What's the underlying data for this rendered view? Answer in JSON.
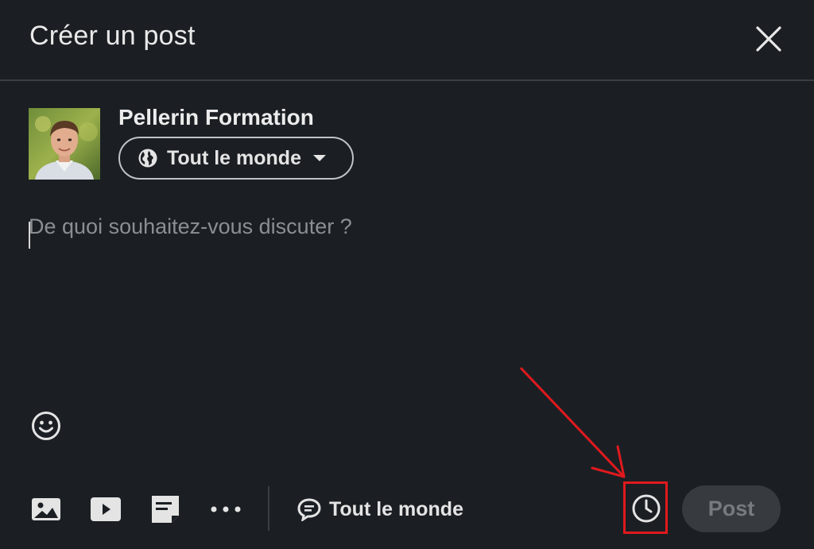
{
  "header": {
    "title": "Créer un post"
  },
  "author": {
    "name": "Pellerin Formation",
    "audience_label": "Tout le monde"
  },
  "composer": {
    "placeholder": "De quoi souhaitez-vous discuter ?"
  },
  "toolbar": {
    "icons": [
      "image-icon",
      "video-icon",
      "document-icon",
      "more-icon"
    ],
    "comment_audience_label": "Tout le monde",
    "post_label": "Post"
  },
  "annotation": {
    "highlight_color": "#e0191e",
    "target": "clock-icon"
  },
  "colors": {
    "background": "#1b1f23",
    "text": "#e8e8e8",
    "placeholder": "#8a8f94",
    "post_button_bg": "#373b40",
    "post_button_text": "#777b80"
  }
}
